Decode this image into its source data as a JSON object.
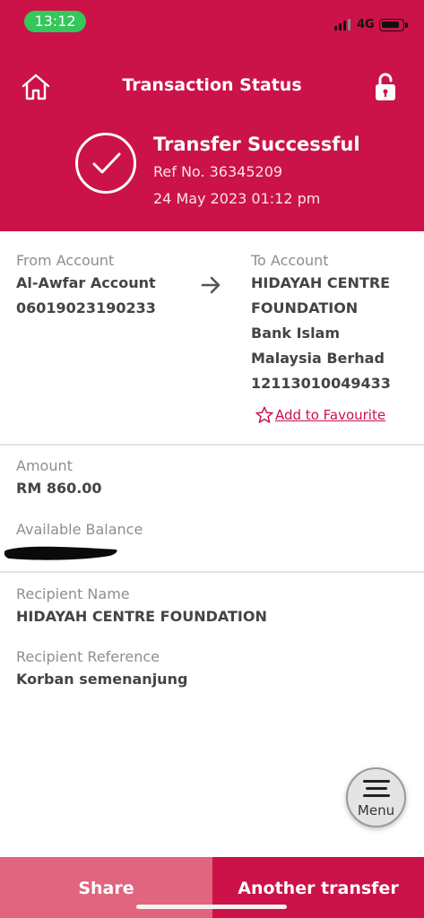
{
  "status_bar": {
    "time": "13:12",
    "network": "4G"
  },
  "header": {
    "title": "Transaction Status",
    "status_title": "Transfer Successful",
    "ref_no": "Ref No. 36345209",
    "datetime": "24 May 2023 01:12 pm"
  },
  "from_account": {
    "label": "From Account",
    "name": "Al-Awfar Account",
    "number": "06019023190233"
  },
  "to_account": {
    "label": "To Account",
    "name_line1": "HIDAYAH CENTRE",
    "name_line2": "FOUNDATION",
    "bank_line1": "Bank Islam",
    "bank_line2": "Malaysia Berhad",
    "number": "12113010049433",
    "favourite_label": "Add to Favourite"
  },
  "amount": {
    "label": "Amount",
    "value": "RM 860.00"
  },
  "balance": {
    "label": "Available Balance"
  },
  "recipient": {
    "name_label": "Recipient Name",
    "name_value": "HIDAYAH CENTRE FOUNDATION",
    "reference_label": "Recipient Reference",
    "reference_value": "Korban semenanjung"
  },
  "menu": {
    "label": "Menu"
  },
  "actions": {
    "share_label": "Share",
    "another_label": "Another transfer"
  },
  "colors": {
    "brand": "#cb1249",
    "share": "#e0657f",
    "success_pill": "#34c759"
  },
  "icons": [
    "home-icon",
    "unlock-icon",
    "check-circle-icon",
    "arrow-right-icon",
    "star-icon",
    "menu-icon"
  ]
}
